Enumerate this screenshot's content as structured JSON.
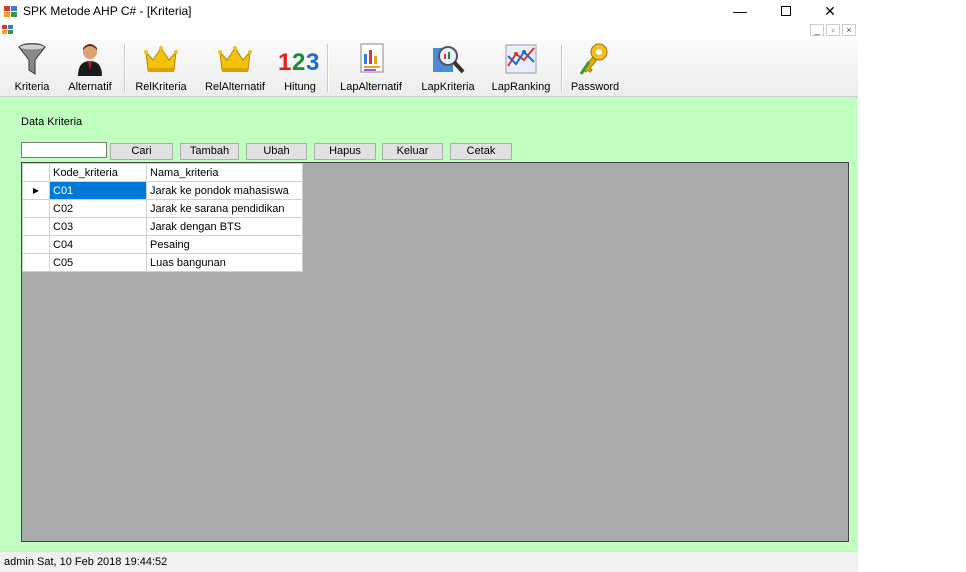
{
  "window": {
    "title": "SPK Metode AHP C# - [Kriteria]",
    "minimize_icon": "minimize-icon",
    "maximize_icon": "maximize-icon",
    "close_icon": "close-icon"
  },
  "toolbar": {
    "items": [
      {
        "label": "Kriteria",
        "icon": "funnel-icon"
      },
      {
        "label": "Alternatif",
        "icon": "person-icon"
      },
      {
        "label": "RelKriteria",
        "icon": "crown-icon"
      },
      {
        "label": "RelAlternatif",
        "icon": "crown-icon"
      },
      {
        "label": "Hitung",
        "icon": "numbers-123-icon"
      },
      {
        "label": "LapAlternatif",
        "icon": "report-icon"
      },
      {
        "label": "LapKriteria",
        "icon": "magnifier-report-icon"
      },
      {
        "label": "LapRanking",
        "icon": "chart-icon"
      },
      {
        "label": "Password",
        "icon": "keys-icon"
      }
    ]
  },
  "form": {
    "section_label": "Data Kriteria",
    "search_value": "",
    "buttons": {
      "cari": "Cari",
      "tambah": "Tambah",
      "ubah": "Ubah",
      "hapus": "Hapus",
      "keluar": "Keluar",
      "cetak": "Cetak"
    }
  },
  "grid": {
    "columns": [
      "Kode_kriteria",
      "Nama_kriteria"
    ],
    "rows": [
      {
        "kode": "C01",
        "nama": "Jarak ke pondok mahasiswa"
      },
      {
        "kode": "C02",
        "nama": "Jarak ke sarana pendidikan"
      },
      {
        "kode": "C03",
        "nama": "Jarak dengan BTS"
      },
      {
        "kode": "C04",
        "nama": "Pesaing"
      },
      {
        "kode": "C05",
        "nama": "Luas bangunan"
      }
    ],
    "current_row_indicator": "▶"
  },
  "status": {
    "text": "admin Sat, 10 Feb 2018 19:44:52"
  },
  "colors": {
    "client_background": "#c0ffc0",
    "grid_background": "#ababab",
    "selection": "#0078d7"
  }
}
